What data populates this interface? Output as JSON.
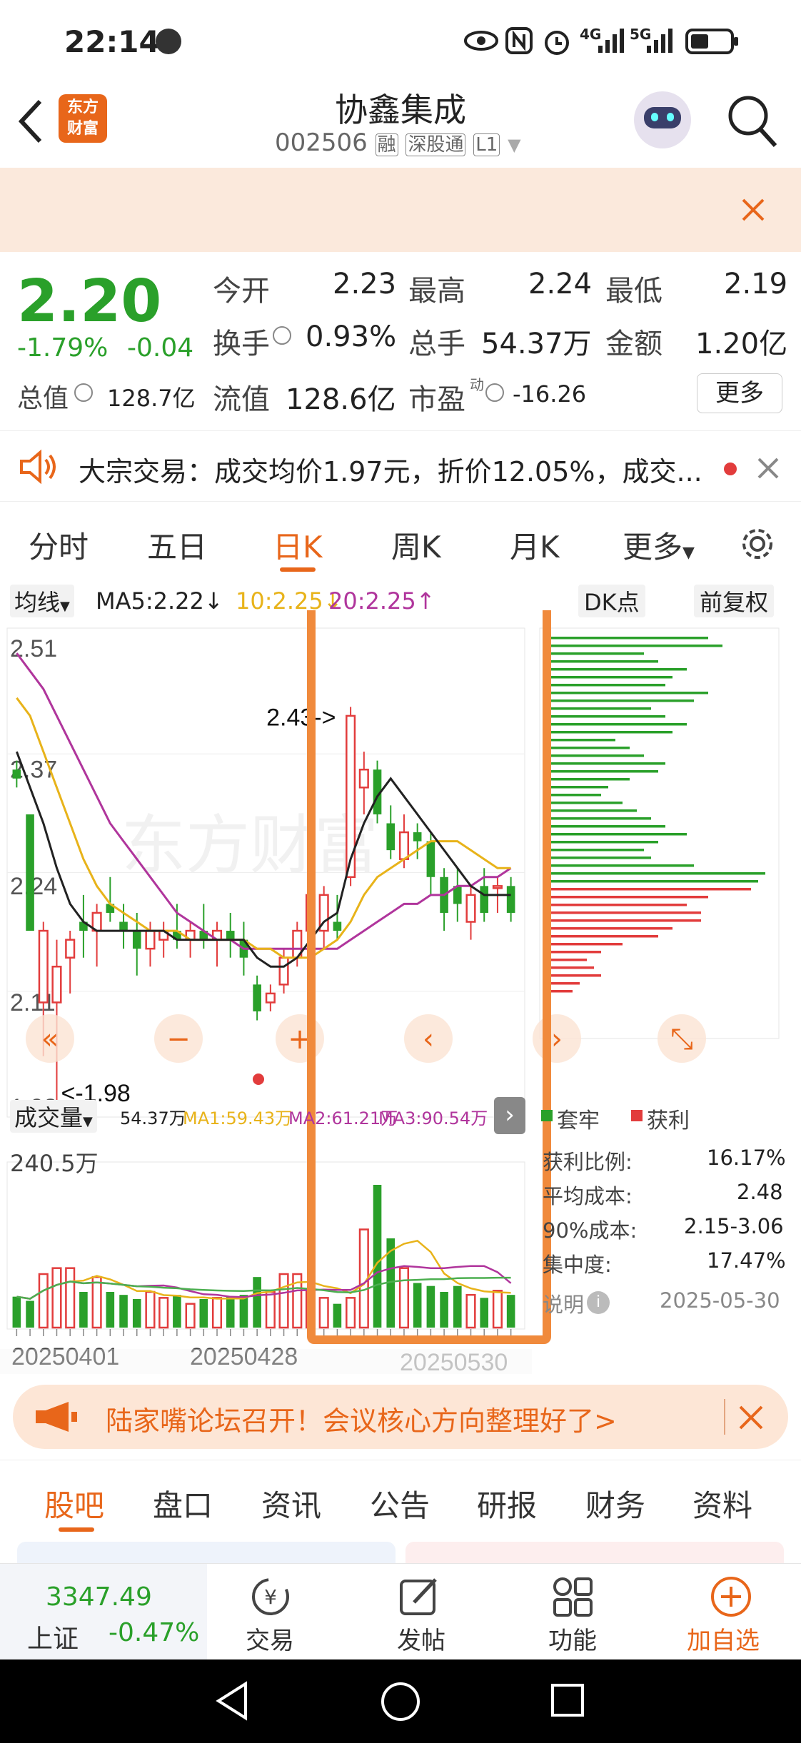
{
  "status_bar": {
    "time": "22:14",
    "network_4g": "4G",
    "network_5g": "5G"
  },
  "header": {
    "title": "协鑫集成",
    "code": "002506",
    "tag_rong": "融",
    "tag_connect": "深股通",
    "tag_level": "L1",
    "logo_text_1": "东方",
    "logo_text_2": "财富"
  },
  "quote": {
    "price": "2.20",
    "change_pct": "-1.79%",
    "change_amt": "-0.04",
    "open_label": "今开",
    "open_value": "2.23",
    "high_label": "最高",
    "high_value": "2.24",
    "low_label": "最低",
    "low_value": "2.19",
    "turnover_label": "换手",
    "turnover_value": "0.93%",
    "volume_label": "总手",
    "volume_value": "54.37万",
    "amount_label": "金额",
    "amount_value": "1.20亿",
    "mktcap_label": "总值",
    "mktcap_value": "128.7亿",
    "float_label": "流值",
    "float_value": "128.6亿",
    "pe_label": "市盈",
    "pe_sup": "动",
    "pe_value": "-16.26",
    "more_button": "更多"
  },
  "notice": {
    "text": "大宗交易：成交均价1.97元，折价12.05%，成交..."
  },
  "tabs": [
    "分时",
    "五日",
    "日K",
    "周K",
    "月K",
    "更多"
  ],
  "active_tab": "日K",
  "chart_header": {
    "ma_select": "均线",
    "ma5": "MA5:2.22↓",
    "ma10": "10:2.25↓",
    "ma20": "20:2.25↑",
    "dk_button": "DK点",
    "adjust_button": "前复权"
  },
  "chart_data": {
    "type": "candlestick",
    "ylim": [
      1.98,
      2.51
    ],
    "y_ticks": [
      "2.51",
      "2.37",
      "2.24",
      "2.11",
      "1.98"
    ],
    "x_labels": [
      "20250401",
      "20250428",
      "20250530"
    ],
    "annotations": [
      "2.43->",
      "<-1.98"
    ],
    "candles": [
      {
        "o": 2.36,
        "h": 2.37,
        "l": 2.34,
        "c": 2.35,
        "d": "down"
      },
      {
        "o": 2.31,
        "h": 2.31,
        "l": 2.18,
        "c": 2.18,
        "d": "down"
      },
      {
        "o": 2.1,
        "h": 2.19,
        "l": 2.04,
        "c": 2.18,
        "d": "up"
      },
      {
        "o": 2.1,
        "h": 2.17,
        "l": 1.98,
        "c": 2.14,
        "d": "up"
      },
      {
        "o": 2.15,
        "h": 2.18,
        "l": 2.11,
        "c": 2.17,
        "d": "up"
      },
      {
        "o": 2.19,
        "h": 2.22,
        "l": 2.15,
        "c": 2.18,
        "d": "down"
      },
      {
        "o": 2.18,
        "h": 2.21,
        "l": 2.14,
        "c": 2.2,
        "d": "up"
      },
      {
        "o": 2.21,
        "h": 2.24,
        "l": 2.19,
        "c": 2.2,
        "d": "down"
      },
      {
        "o": 2.19,
        "h": 2.21,
        "l": 2.16,
        "c": 2.18,
        "d": "down"
      },
      {
        "o": 2.18,
        "h": 2.2,
        "l": 2.13,
        "c": 2.16,
        "d": "down"
      },
      {
        "o": 2.16,
        "h": 2.19,
        "l": 2.14,
        "c": 2.18,
        "d": "up"
      },
      {
        "o": 2.17,
        "h": 2.19,
        "l": 2.15,
        "c": 2.18,
        "d": "up"
      },
      {
        "o": 2.18,
        "h": 2.21,
        "l": 2.16,
        "c": 2.17,
        "d": "down"
      },
      {
        "o": 2.17,
        "h": 2.19,
        "l": 2.15,
        "c": 2.18,
        "d": "up"
      },
      {
        "o": 2.18,
        "h": 2.21,
        "l": 2.16,
        "c": 2.17,
        "d": "down"
      },
      {
        "o": 2.17,
        "h": 2.19,
        "l": 2.14,
        "c": 2.18,
        "d": "up"
      },
      {
        "o": 2.18,
        "h": 2.2,
        "l": 2.15,
        "c": 2.17,
        "d": "down"
      },
      {
        "o": 2.17,
        "h": 2.19,
        "l": 2.13,
        "c": 2.15,
        "d": "down"
      },
      {
        "o": 2.12,
        "h": 2.13,
        "l": 2.08,
        "c": 2.09,
        "d": "down"
      },
      {
        "o": 2.1,
        "h": 2.12,
        "l": 2.09,
        "c": 2.11,
        "d": "up"
      },
      {
        "o": 2.12,
        "h": 2.16,
        "l": 2.11,
        "c": 2.15,
        "d": "up"
      },
      {
        "o": 2.15,
        "h": 2.19,
        "l": 2.14,
        "c": 2.18,
        "d": "up"
      },
      {
        "o": 2.18,
        "h": 2.23,
        "l": 2.17,
        "c": 2.22,
        "d": "up"
      },
      {
        "o": 2.18,
        "h": 2.23,
        "l": 2.16,
        "c": 2.22,
        "d": "up"
      },
      {
        "o": 2.19,
        "h": 2.22,
        "l": 2.17,
        "c": 2.18,
        "d": "down"
      },
      {
        "o": 2.24,
        "h": 2.43,
        "l": 2.23,
        "c": 2.42,
        "d": "up"
      },
      {
        "o": 2.34,
        "h": 2.38,
        "l": 2.31,
        "c": 2.36,
        "d": "up"
      },
      {
        "o": 2.36,
        "h": 2.37,
        "l": 2.3,
        "c": 2.31,
        "d": "down"
      },
      {
        "o": 2.3,
        "h": 2.32,
        "l": 2.26,
        "c": 2.27,
        "d": "down"
      },
      {
        "o": 2.26,
        "h": 2.31,
        "l": 2.25,
        "c": 2.29,
        "d": "up"
      },
      {
        "o": 2.28,
        "h": 2.3,
        "l": 2.26,
        "c": 2.29,
        "d": "down"
      },
      {
        "o": 2.28,
        "h": 2.29,
        "l": 2.22,
        "c": 2.24,
        "d": "down"
      },
      {
        "o": 2.24,
        "h": 2.25,
        "l": 2.18,
        "c": 2.2,
        "d": "down"
      },
      {
        "o": 2.23,
        "h": 2.25,
        "l": 2.19,
        "c": 2.21,
        "d": "down"
      },
      {
        "o": 2.19,
        "h": 2.23,
        "l": 2.17,
        "c": 2.22,
        "d": "up"
      },
      {
        "o": 2.23,
        "h": 2.25,
        "l": 2.19,
        "c": 2.2,
        "d": "down"
      },
      {
        "o": 2.23,
        "h": 2.24,
        "l": 2.2,
        "c": 2.23,
        "d": "up"
      },
      {
        "o": 2.23,
        "h": 2.24,
        "l": 2.19,
        "c": 2.2,
        "d": "down"
      }
    ],
    "ma5": [
      2.38,
      2.34,
      2.3,
      2.25,
      2.21,
      2.19,
      2.18,
      2.18,
      2.18,
      2.18,
      2.18,
      2.18,
      2.17,
      2.17,
      2.17,
      2.17,
      2.17,
      2.17,
      2.15,
      2.14,
      2.14,
      2.15,
      2.17,
      2.19,
      2.2,
      2.26,
      2.3,
      2.33,
      2.35,
      2.33,
      2.31,
      2.29,
      2.27,
      2.25,
      2.23,
      2.22,
      2.22,
      2.22
    ],
    "ma10": [
      2.44,
      2.42,
      2.38,
      2.34,
      2.3,
      2.26,
      2.23,
      2.21,
      2.2,
      2.19,
      2.18,
      2.18,
      2.18,
      2.17,
      2.17,
      2.17,
      2.17,
      2.17,
      2.16,
      2.16,
      2.15,
      2.15,
      2.15,
      2.16,
      2.17,
      2.19,
      2.22,
      2.24,
      2.25,
      2.26,
      2.27,
      2.28,
      2.28,
      2.28,
      2.27,
      2.26,
      2.25,
      2.25
    ],
    "ma20": [
      2.49,
      2.47,
      2.45,
      2.42,
      2.39,
      2.36,
      2.33,
      2.3,
      2.28,
      2.26,
      2.24,
      2.22,
      2.2,
      2.19,
      2.18,
      2.17,
      2.17,
      2.16,
      2.16,
      2.16,
      2.16,
      2.16,
      2.16,
      2.16,
      2.16,
      2.17,
      2.18,
      2.19,
      2.2,
      2.21,
      2.21,
      2.22,
      2.22,
      2.23,
      2.23,
      2.24,
      2.24,
      2.25
    ],
    "volume": {
      "label": "成交量",
      "current": "54.37万",
      "ma1": "MA1:59.43万",
      "ma2": "MA2:61.21万",
      "ma3": "MA3:90.54万",
      "ymax_label": "240.5万",
      "values": [
        52,
        45,
        90,
        100,
        100,
        60,
        85,
        60,
        55,
        48,
        60,
        50,
        55,
        40,
        48,
        50,
        52,
        55,
        85,
        60,
        90,
        90,
        60,
        50,
        40,
        50,
        165,
        240,
        150,
        100,
        75,
        70,
        60,
        70,
        55,
        50,
        62,
        55
      ]
    },
    "chip_distribution": {
      "legend_trapped": "套牢",
      "legend_profit": "获利",
      "profit_ratio_label": "获利比例:",
      "profit_ratio_value": "16.17%",
      "avg_cost_label": "平均成本:",
      "avg_cost_value": "2.48",
      "cost90_label": "90%成本:",
      "cost90_value": "2.15-3.06",
      "concentration_label": "集中度:",
      "concentration_value": "17.47%",
      "note_label": "说明",
      "date": "2025-05-30",
      "bars_green": [
        230,
        250,
        140,
        160,
        200,
        180,
        170,
        230,
        210,
        150,
        170,
        200,
        180,
        100,
        120,
        140,
        170,
        160,
        120,
        90,
        80,
        110,
        130,
        150,
        170,
        200,
        160,
        140,
        150,
        210,
        310,
        300
      ],
      "bars_red": [
        290,
        230,
        200,
        220,
        220,
        180,
        160,
        110,
        80,
        60,
        70,
        80,
        50,
        40
      ]
    }
  },
  "banner2": {
    "text": "陆家嘴论坛召开！会议核心方向整理好了>"
  },
  "bottom_tabs": [
    "股吧",
    "盘口",
    "资讯",
    "公告",
    "研报",
    "财务",
    "资料"
  ],
  "bottom_bar": {
    "index_value": "3347.49",
    "index_name": "上证",
    "index_change": "-0.47%",
    "trade": "交易",
    "post": "发帖",
    "function": "功能",
    "add": "加自选"
  },
  "colors": {
    "accent": "#e8661a",
    "up": "#e23c3c",
    "down": "#2aa02a",
    "ma5": "#222222",
    "ma10": "#e8b31a",
    "ma20": "#b0359c",
    "highlight_box": "#f08a3c"
  }
}
